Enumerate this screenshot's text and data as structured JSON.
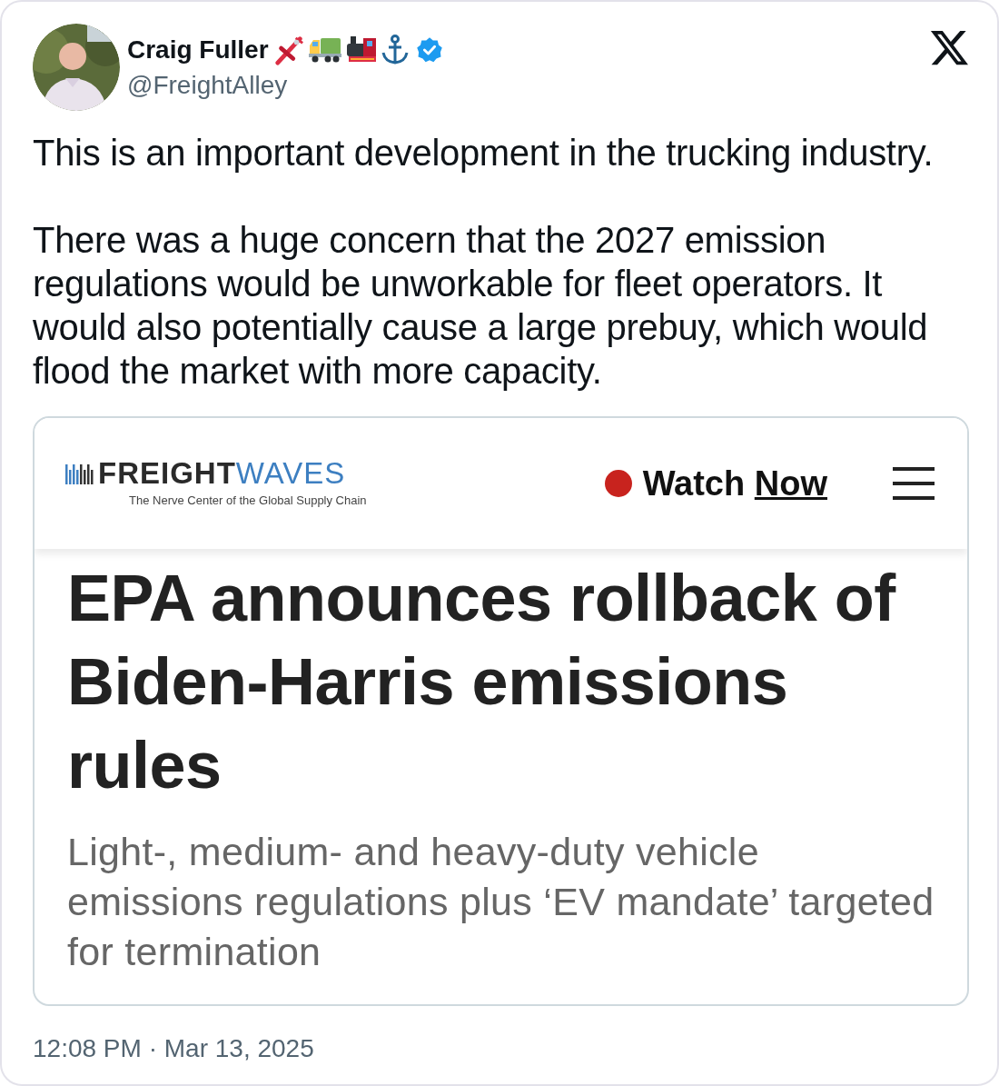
{
  "author": {
    "name": "Craig Fuller",
    "handle": "@FreightAlley",
    "verified": true
  },
  "tweet": {
    "paragraphs": [
      "This is an important development in the trucking industry.",
      "There was a huge concern that the 2027 emission regulations would be unworkable for fleet operators. It would also potentially cause a large prebuy, which would flood the market with more capacity."
    ]
  },
  "embed": {
    "logo": {
      "word_1": "FREIGHT",
      "word_2": "WAVES",
      "tagline": "The Nerve Center of the Global Supply Chain"
    },
    "watch": {
      "label_1": "Watch",
      "label_2": "Now",
      "live": true
    },
    "headline": "EPA announces rollback of Biden-Harris emissions rules",
    "subheadline": "Light-, medium- and heavy-duty vehicle emissions regulations plus ‘EV mandate’ targeted for termination"
  },
  "timestamp": "12:08 PM · Mar 13, 2025"
}
